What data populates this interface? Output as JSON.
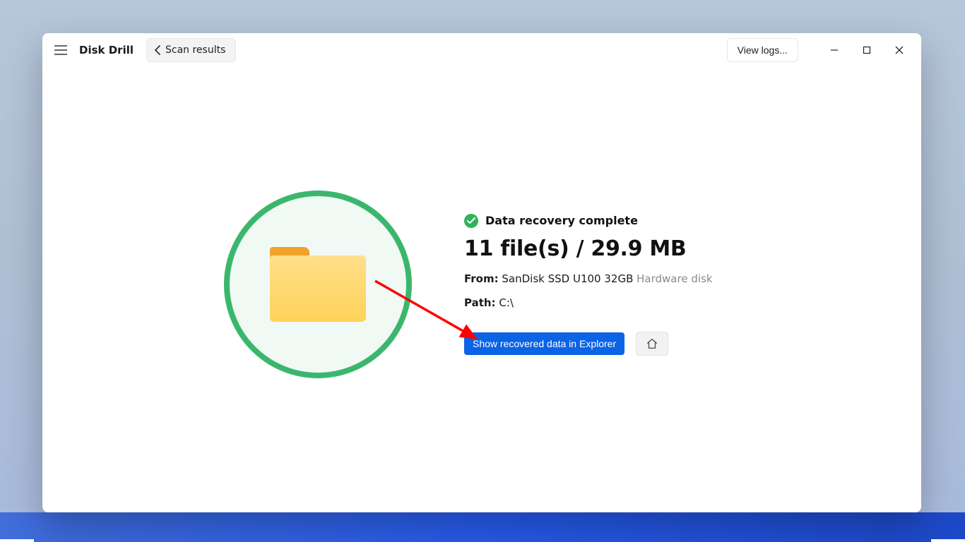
{
  "app": {
    "title": "Disk Drill"
  },
  "header": {
    "back_label": "Scan results",
    "view_logs_label": "View logs..."
  },
  "result": {
    "status_text": "Data recovery complete",
    "summary": "11 file(s) / 29.9 MB",
    "from_label": "From:",
    "from_value": "SanDisk SSD U100 32GB",
    "from_muted": "Hardware disk",
    "path_label": "Path:",
    "path_value": "C:\\",
    "primary_button": "Show recovered data in Explorer"
  },
  "colors": {
    "accent_green": "#3bb76d",
    "primary_blue": "#0b63e6"
  }
}
